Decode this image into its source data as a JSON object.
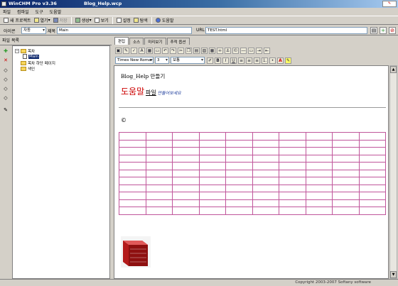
{
  "window": {
    "app_title": "WinCHM Pro v3.36",
    "doc_title": "Blog_Help.wcp"
  },
  "menu": [
    "파일",
    "컴파일",
    "도구",
    "도움말"
  ],
  "toolbar": [
    {
      "label": "새 프로젝트",
      "icon": "new-project-icon"
    },
    {
      "label": "열기",
      "icon": "open-folder-icon"
    },
    {
      "label": "저장",
      "icon": "save-icon"
    },
    {
      "label": "생성",
      "icon": "build-icon"
    },
    {
      "label": "보기",
      "icon": "view-icon"
    },
    {
      "label": "설정",
      "icon": "settings-icon"
    },
    {
      "label": "탐색",
      "icon": "explore-icon"
    },
    {
      "label": "도움말",
      "icon": "help-icon"
    }
  ],
  "props": {
    "icon_label": "아이콘",
    "icon_value": "자동",
    "title_label": "제목",
    "title_value": "Main",
    "url_label": "URL",
    "url_value": "TEST.html"
  },
  "left_panel": {
    "title": "파일 목록",
    "tree": [
      {
        "label": "목차",
        "type": "folder",
        "level": 0
      },
      {
        "label": "Main",
        "type": "page",
        "level": 1,
        "selected": true
      },
      {
        "label": "목차 하단 페이지",
        "type": "folder",
        "level": 0
      },
      {
        "label": "색인",
        "type": "folder",
        "level": 0
      }
    ]
  },
  "tabs": [
    "편집",
    "소스",
    "미리보기",
    "추적 옵션"
  ],
  "format": {
    "font_name": "Times New Roman",
    "font_size": "3",
    "style": "보통"
  },
  "editor": {
    "heading": "Blog_Help 만들기",
    "big_text": "도움말",
    "file_text": "파일",
    "link_text": "만들어보세요",
    "copyright_symbol": "©",
    "table": {
      "rows": 11,
      "cols": 10
    }
  },
  "status": {
    "copyright": "Copyright 2003-2007 Softany software"
  },
  "colors": {
    "title_start": "#0a246a",
    "title_end": "#a6caf0",
    "table_border": "#c0569b",
    "big_text": "#cc0000",
    "link": "#1a3a9a"
  }
}
